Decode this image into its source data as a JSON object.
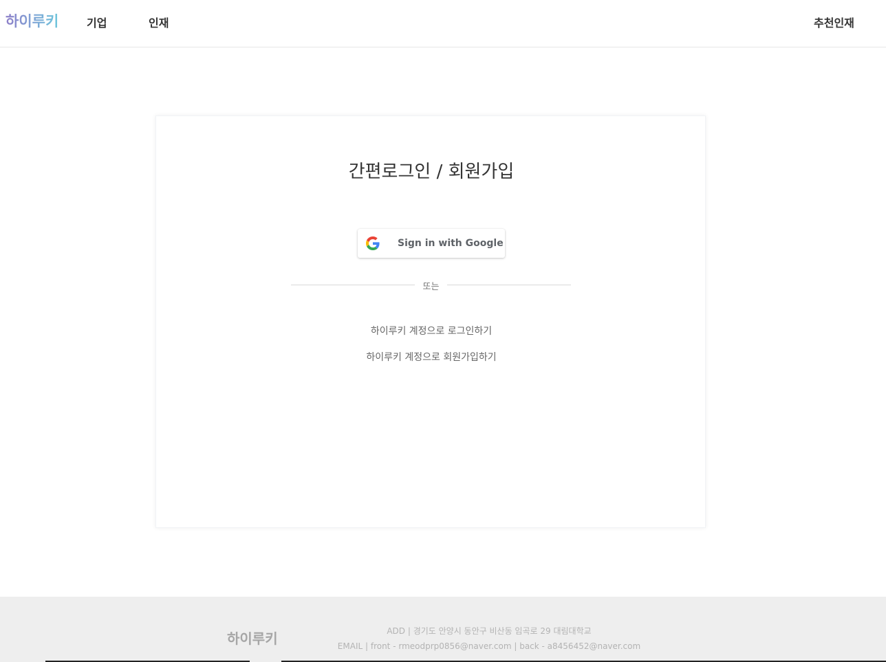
{
  "header": {
    "logo": "하이루키",
    "nav": {
      "company": "기업",
      "talent": "인재",
      "recommend": "추천인재"
    }
  },
  "auth": {
    "title": "간편로그인 / 회원가입",
    "google_button": "Sign in with Google",
    "divider": "또는",
    "login_link": "하이루키 계정으로 로그인하기",
    "signup_link": "하이루키 계정으로 회원가입하기"
  },
  "footer": {
    "logo": "하이루키",
    "address": "ADD | 경기도 안양시 동안구 비산동 임곡로 29 대림대학교",
    "email": "EMAIL | front - rmeodprp0856@naver.com | back - a8456452@naver.com"
  },
  "colors": {
    "logo_gradient": [
      "#8e7fc9",
      "#6fc6dc"
    ],
    "footer_bg": "#eeeeee"
  }
}
